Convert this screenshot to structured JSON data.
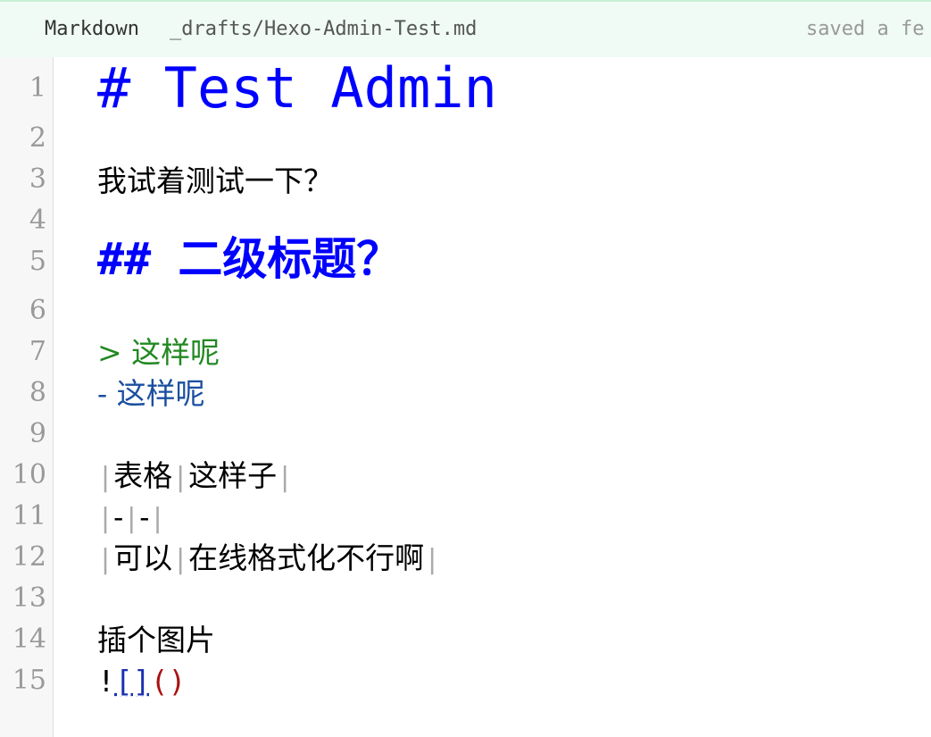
{
  "header": {
    "mode": "Markdown",
    "file_path": "_drafts/Hexo-Admin-Test.md",
    "status": "saved a fe"
  },
  "editor": {
    "line_numbers": [
      "1",
      "2",
      "3",
      "4",
      "5",
      "6",
      "7",
      "8",
      "9",
      "10",
      "11",
      "12",
      "13",
      "14",
      "15"
    ],
    "line1": "# Test Admin",
    "line3": "我试着测试一下？",
    "line5_marker": "## ",
    "line5_text": "二级标题？",
    "line7_marker": "> ",
    "line7_text": "这样呢",
    "line8_marker": "- ",
    "line8_text": "这样呢",
    "line10_cells": [
      "表格",
      "这样子"
    ],
    "line11_cells": [
      "-",
      "-"
    ],
    "line12_cells": [
      "可以",
      "在线格式化不行啊"
    ],
    "line14": "插个图片",
    "line15_bang": "!",
    "line15_bracket": "[]",
    "line15_paren": "()"
  },
  "colors": {
    "heading": "#0000ff",
    "quote": "#228822",
    "list": "#1a4fa0",
    "link_bracket": "#1a2fb0",
    "link_url": "#aa1111",
    "topbar_bg": "#effbf4"
  }
}
